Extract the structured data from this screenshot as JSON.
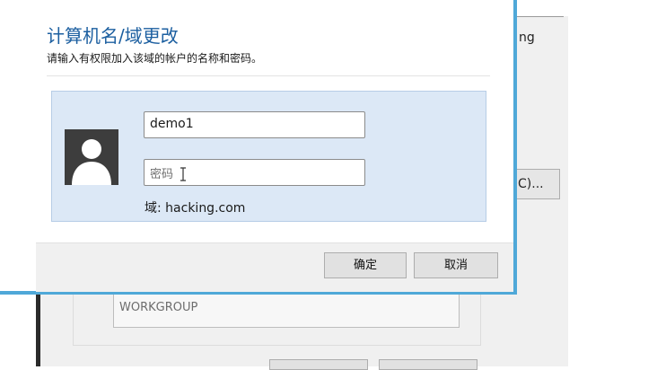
{
  "background": {
    "fragment_text": "ng",
    "fragment_button_label": "C)...",
    "workgroup_value": "WORKGROUP"
  },
  "dialog": {
    "title": "计算机名/域更改",
    "subtitle": "请输入有权限加入该域的帐户的名称和密码。",
    "username_value": "demo1",
    "password_placeholder": "密码",
    "domain_label": "域: hacking.com",
    "ok_label": "确定",
    "cancel_label": "取消",
    "icons": [
      "user-avatar-icon",
      "text-cursor-icon"
    ],
    "colors": {
      "title": "#1c5fa0",
      "panel": "#dce8f6",
      "window_border": "#4fa8d8"
    }
  }
}
